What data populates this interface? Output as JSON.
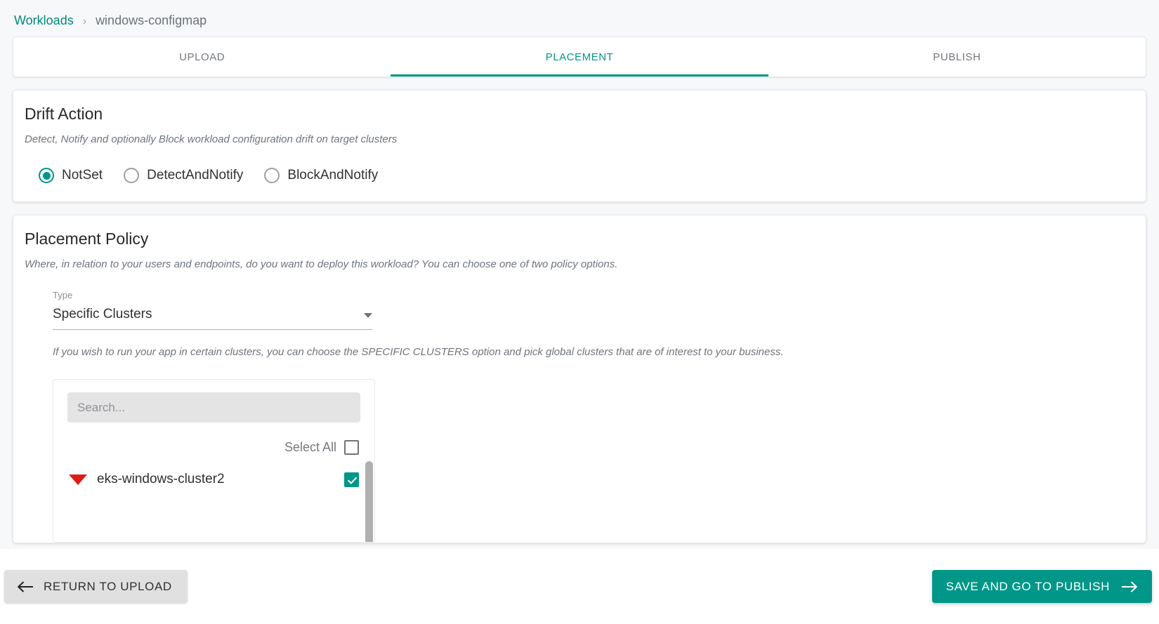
{
  "breadcrumb": {
    "parent": "Workloads",
    "separator": "›",
    "current": "windows-configmap"
  },
  "tabs": [
    {
      "label": "UPLOAD",
      "active": false
    },
    {
      "label": "PLACEMENT",
      "active": true
    },
    {
      "label": "PUBLISH",
      "active": false
    }
  ],
  "drift_action": {
    "title": "Drift Action",
    "subtitle": "Detect, Notify and optionally Block workload configuration drift on target clusters",
    "options": [
      {
        "label": "NotSet",
        "selected": true
      },
      {
        "label": "DetectAndNotify",
        "selected": false
      },
      {
        "label": "BlockAndNotify",
        "selected": false
      }
    ]
  },
  "placement_policy": {
    "title": "Placement Policy",
    "subtitle": "Where, in relation to your users and endpoints, do you want to deploy this workload? You can choose one of two policy options.",
    "type_label": "Type",
    "type_value": "Specific Clusters",
    "hint": "If you wish to run your app in certain clusters, you can choose the SPECIFIC CLUSTERS option and pick global clusters that are of interest to your business.",
    "picker": {
      "search_placeholder": "Search...",
      "search_value": "",
      "select_all_label": "Select All",
      "select_all_checked": false,
      "clusters": [
        {
          "name": "eks-windows-cluster2",
          "checked": true,
          "expanded": true
        }
      ]
    }
  },
  "bottom_bar": {
    "back_label": "RETURN TO UPLOAD",
    "next_label": "SAVE AND GO TO PUBLISH"
  },
  "colors": {
    "accent": "#009688",
    "accent_link": "#00897b",
    "page_bg": "#f7f8fa",
    "card_bg": "#ffffff",
    "muted_text": "#6f757c",
    "cluster_marker": "#e01b16",
    "search_bg": "#e4e4e4",
    "back_button_bg": "#e0e0e0"
  }
}
